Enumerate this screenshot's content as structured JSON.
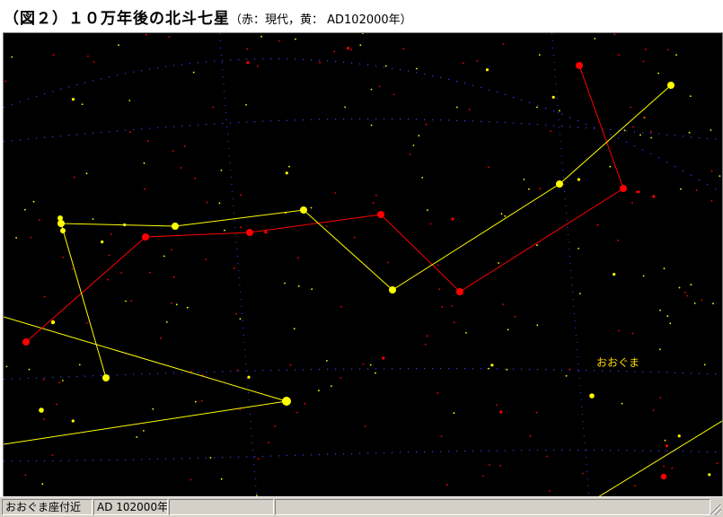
{
  "title": {
    "main": "（図２）１０万年後の北斗七星",
    "subtitle": "（赤：現代，黄： AD102000年）"
  },
  "sky": {
    "constellation_label": "おおぐま",
    "colors": {
      "background": "#000000",
      "modern": "#ff0000",
      "future": "#ffff00",
      "grid_dots": "#3a3aff",
      "label": "#ffd700"
    }
  },
  "status_bar": {
    "location": "おおぐま座付近",
    "epoch": "AD 102000年",
    "panel3": "",
    "panel4": ""
  }
}
